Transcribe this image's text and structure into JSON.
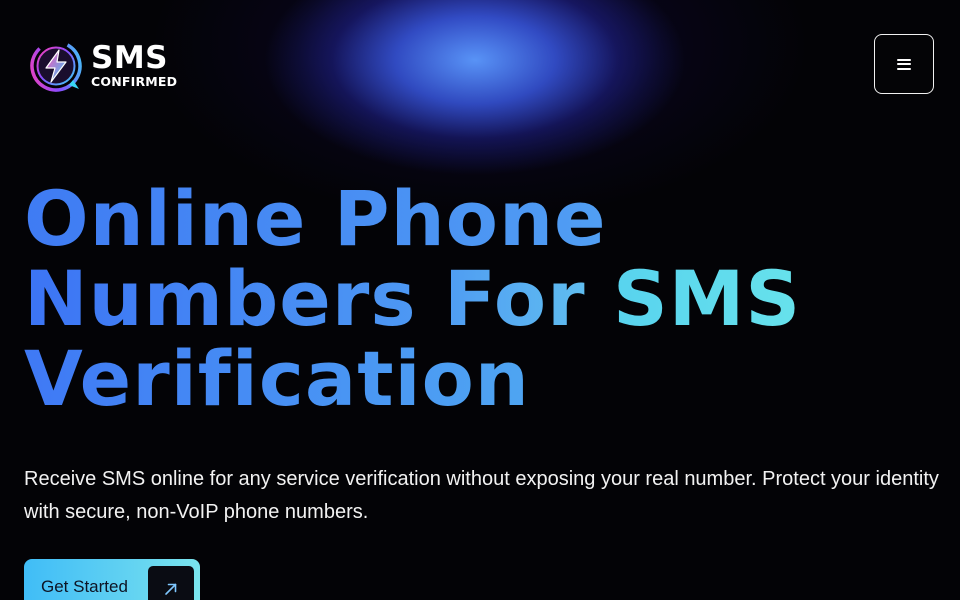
{
  "header": {
    "logo": {
      "wordmark": "SMS",
      "subtitle": "CONFIRMED"
    },
    "menu_icon": "hamburger-menu-icon"
  },
  "hero": {
    "headline": {
      "line1": "Online Phone",
      "line2_start": "Numbers For ",
      "line2_accent": "SMS",
      "line3": "Verification"
    },
    "description": "Receive SMS online for any service verification without exposing your real number. Protect your identity with secure, non-VoIP phone numbers.",
    "cta": {
      "label": "Get Started",
      "icon": "arrow-up-right-icon"
    }
  },
  "colors": {
    "background": "#030306",
    "headline_blue": "#4c86f5",
    "accent_cyan": "#5fd6ee",
    "cta_gradient_start": "#40bdf7",
    "cta_gradient_end": "#7ae5ee",
    "text": "#f2f2f2"
  }
}
